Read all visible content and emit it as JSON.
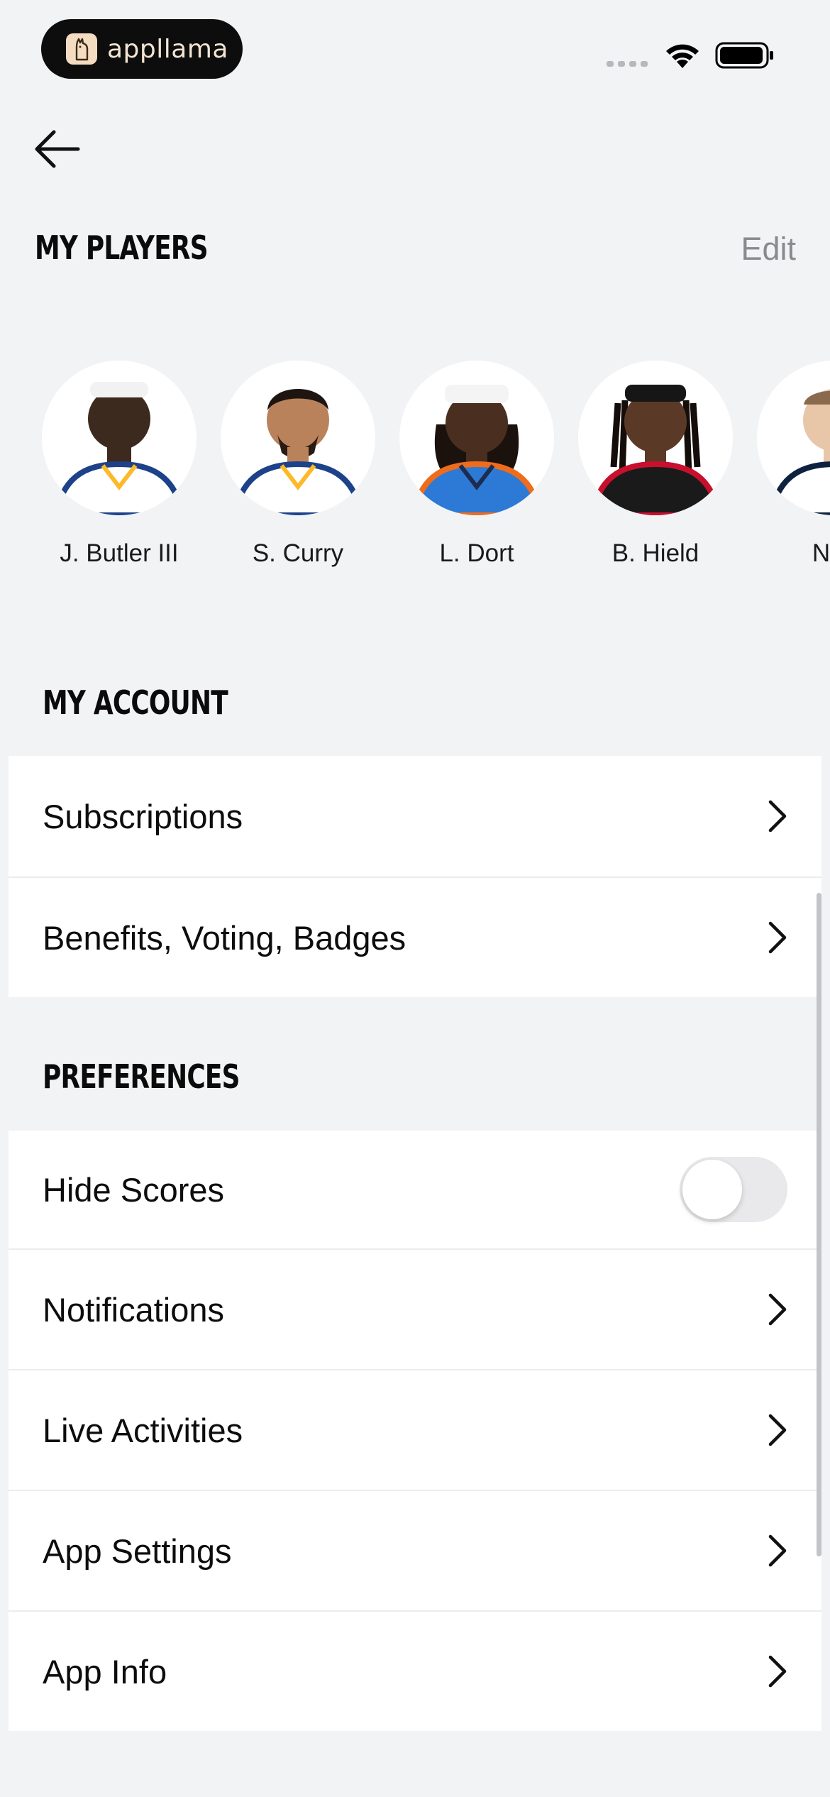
{
  "status_bar": {
    "brand_name": "appllama"
  },
  "header": {
    "back_icon": "arrow-left-icon"
  },
  "my_players": {
    "title": "MY PLAYERS",
    "edit_label": "Edit",
    "players": [
      {
        "name": "J. Butler III",
        "jersey": "#ffffff",
        "trim": "#1d428a"
      },
      {
        "name": "S. Curry",
        "jersey": "#ffffff",
        "trim": "#1d428a"
      },
      {
        "name": "L. Dort",
        "jersey": "#2d7ad6",
        "trim": "#ef6c1b"
      },
      {
        "name": "B. Hield",
        "jersey": "#1a1a1a",
        "trim": "#c8102e"
      },
      {
        "name": "N. J",
        "jersey": "#ffffff",
        "trim": "#0e2240"
      }
    ]
  },
  "my_account": {
    "title": "MY ACCOUNT",
    "items": [
      {
        "label": "Subscriptions"
      },
      {
        "label": "Benefits, Voting, Badges"
      }
    ]
  },
  "preferences": {
    "title": "PREFERENCES",
    "hide_scores": {
      "label": "Hide Scores",
      "on": false
    },
    "items": [
      {
        "label": "Notifications"
      },
      {
        "label": "Live Activities"
      },
      {
        "label": "App Settings"
      },
      {
        "label": "App Info"
      }
    ]
  },
  "colors": {
    "background": "#f2f3f5",
    "card": "#ffffff",
    "muted": "#8a8a8e"
  }
}
